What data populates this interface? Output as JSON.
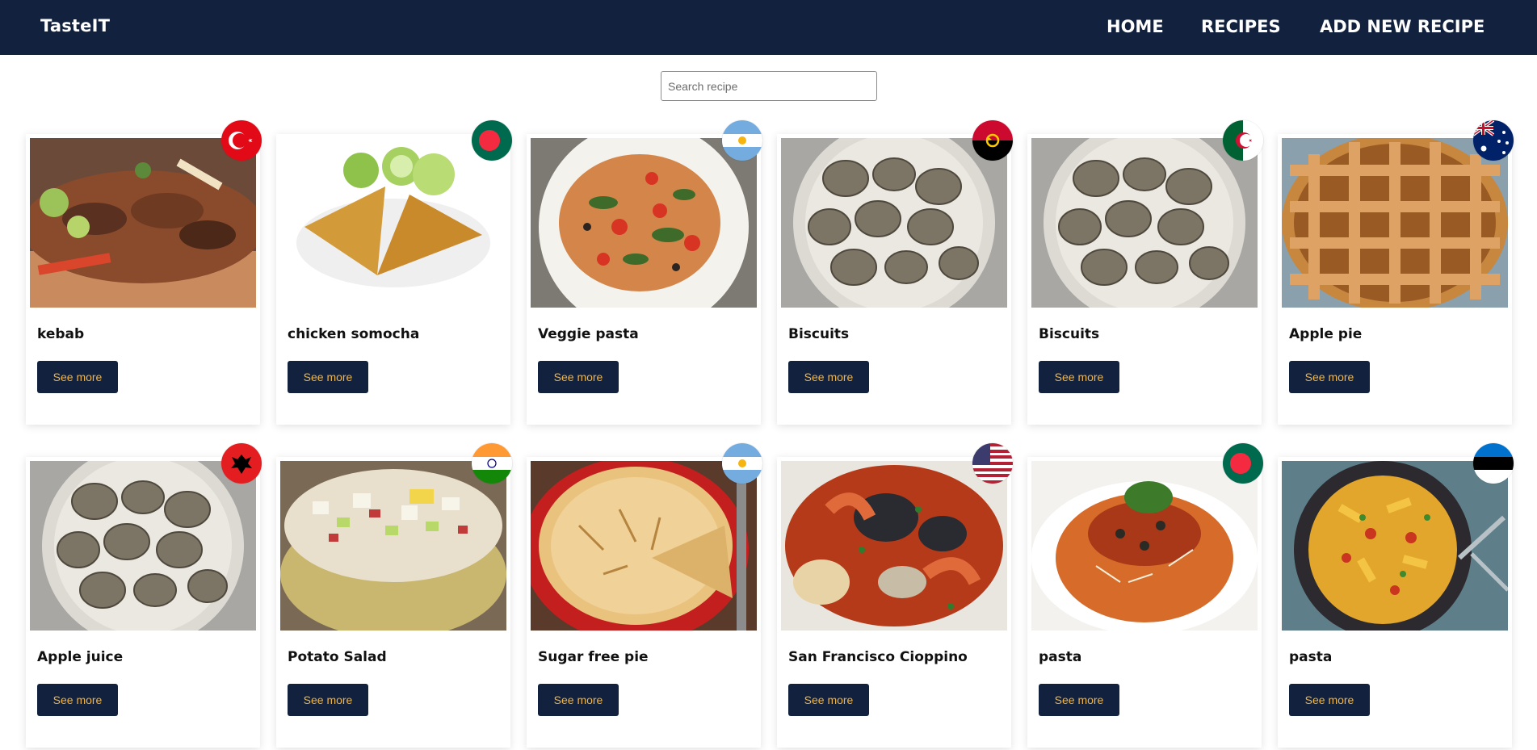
{
  "header": {
    "brand": "TasteIT",
    "nav": [
      {
        "label": "HOME"
      },
      {
        "label": "RECIPES"
      },
      {
        "label": "ADD NEW RECIPE"
      }
    ]
  },
  "search": {
    "placeholder": "Search recipe",
    "value": ""
  },
  "recipes": [
    {
      "title": "kebab",
      "button": "See more",
      "flag": "turkey",
      "photo": "kebab"
    },
    {
      "title": "chicken somocha",
      "button": "See more",
      "flag": "bangladesh",
      "photo": "samosa"
    },
    {
      "title": "Veggie pasta",
      "button": "See more",
      "flag": "argentina",
      "photo": "spaghetti"
    },
    {
      "title": "Biscuits",
      "button": "See more",
      "flag": "angola",
      "photo": "oysters"
    },
    {
      "title": "Biscuits",
      "button": "See more",
      "flag": "algeria",
      "photo": "oysters"
    },
    {
      "title": "Apple pie",
      "button": "See more",
      "flag": "australia",
      "photo": "lattice-pie"
    },
    {
      "title": "Apple juice",
      "button": "See more",
      "flag": "albania",
      "photo": "oysters"
    },
    {
      "title": "Potato Salad",
      "button": "See more",
      "flag": "india",
      "photo": "salad"
    },
    {
      "title": "Sugar free pie",
      "button": "See more",
      "flag": "argentina",
      "photo": "pie"
    },
    {
      "title": "San Francisco Cioppino",
      "button": "See more",
      "flag": "usa",
      "photo": "cioppino"
    },
    {
      "title": "pasta",
      "button": "See more",
      "flag": "bangladesh",
      "photo": "spaghetti-bolognese"
    },
    {
      "title": "pasta",
      "button": "See more",
      "flag": "estonia",
      "photo": "penne"
    }
  ],
  "colors": {
    "navbar": "#12213d",
    "button_bg": "#12213d",
    "button_text": "#f2b544"
  }
}
